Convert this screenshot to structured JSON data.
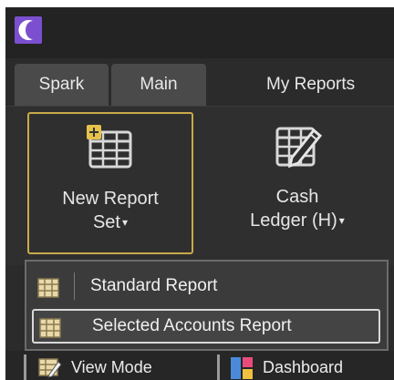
{
  "colors": {
    "window_bg": "#2b2b2b",
    "accent_border": "#c9a94a",
    "logo": "#7b4fd0"
  },
  "tabs": [
    {
      "label": "Spark"
    },
    {
      "label": "Main"
    },
    {
      "label": "My Reports"
    }
  ],
  "ribbon": {
    "new_report_set": {
      "line1": "New Report",
      "line2": "Set",
      "icon": "table-add-icon"
    },
    "cash_ledger": {
      "line1": "Cash",
      "line2": "Ledger (H)",
      "icon": "table-edit-icon"
    }
  },
  "dropdown": {
    "items": [
      {
        "label": "Standard Report",
        "icon": "table-icon"
      },
      {
        "label": "Selected Accounts Report",
        "icon": "table-icon"
      }
    ]
  },
  "bottom": {
    "view_mode": "View Mode",
    "dashboard": "Dashboard"
  }
}
